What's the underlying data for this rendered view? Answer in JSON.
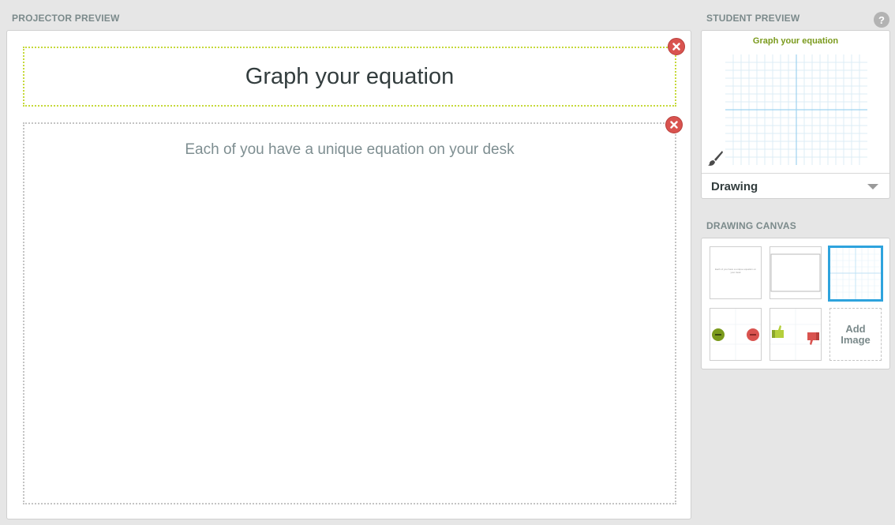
{
  "projector": {
    "label": "PROJECTOR PREVIEW",
    "title": "Graph your equation",
    "body": "Each of you have a unique equation on your desk"
  },
  "student_preview": {
    "label": "STUDENT PREVIEW",
    "help": "?",
    "title": "Graph your equation",
    "dropdown_value": "Drawing"
  },
  "drawing_canvas": {
    "label": "DRAWING CANVAS",
    "thumbnail_text": "Each of you have a unique equation on your desk",
    "add_image_label_line1": "Add",
    "add_image_label_line2": "Image"
  },
  "colors": {
    "background": "#e6e6e6",
    "title_border": "#c6d93a",
    "close_button": "#d9534f",
    "student_title": "#7a9a1c",
    "selected_thumb": "#2ea3dd",
    "grid": "#d6ecf7",
    "axis": "#9fd3f0"
  },
  "icons": {
    "close": "close-icon",
    "help": "help-icon",
    "brush": "brush-icon",
    "caret": "chevron-down-icon"
  }
}
